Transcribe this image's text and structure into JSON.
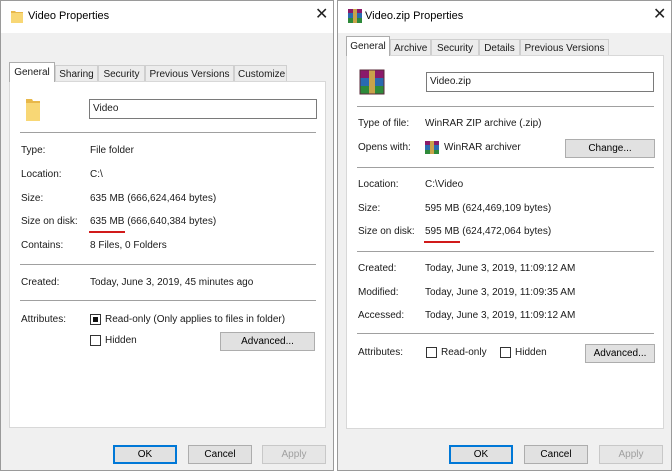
{
  "left": {
    "title": "Video Properties",
    "tabs": [
      "General",
      "Sharing",
      "Security",
      "Previous Versions",
      "Customize"
    ],
    "name_value": "Video",
    "rows": {
      "type_label": "Type:",
      "type_value": "File folder",
      "location_label": "Location:",
      "location_value": "C:\\",
      "size_label": "Size:",
      "size_value": "635 MB (666,624,464 bytes)",
      "sod_label": "Size on disk:",
      "sod_value": "635 MB (666,640,384 bytes)",
      "contains_label": "Contains:",
      "contains_value": "8 Files, 0 Folders",
      "created_label": "Created:",
      "created_value": "Today, June 3, 2019, 45 minutes ago",
      "attributes_label": "Attributes:",
      "readonly_label": "Read-only (Only applies to files in folder)",
      "hidden_label": "Hidden"
    },
    "advanced_label": "Advanced...",
    "ok_label": "OK",
    "cancel_label": "Cancel",
    "apply_label": "Apply"
  },
  "right": {
    "title": "Video.zip Properties",
    "tabs": [
      "General",
      "Archive",
      "Security",
      "Details",
      "Previous Versions"
    ],
    "name_value": "Video.zip",
    "rows": {
      "type_label": "Type of file:",
      "type_value": "WinRAR ZIP archive (.zip)",
      "opens_label": "Opens with:",
      "opens_value": "WinRAR archiver",
      "location_label": "Location:",
      "location_value": "C:\\Video",
      "size_label": "Size:",
      "size_value": "595 MB (624,469,109 bytes)",
      "sod_label": "Size on disk:",
      "sod_value": "595 MB (624,472,064 bytes)",
      "created_label": "Created:",
      "created_value": "Today, June 3, 2019, 11:09:12 AM",
      "modified_label": "Modified:",
      "modified_value": "Today, June 3, 2019, 11:09:35 AM",
      "accessed_label": "Accessed:",
      "accessed_value": "Today, June 3, 2019, 11:09:12 AM",
      "attributes_label": "Attributes:",
      "readonly_label": "Read-only",
      "hidden_label": "Hidden"
    },
    "change_label": "Change...",
    "advanced_label": "Advanced...",
    "ok_label": "OK",
    "cancel_label": "Cancel",
    "apply_label": "Apply"
  },
  "colors": {
    "underline": "#d11a1a",
    "accent": "#0078d7",
    "folder": "#f8d775"
  },
  "icons": {
    "folder": "folder-icon",
    "archive": "winrar-archive-icon",
    "close": "close-icon"
  }
}
